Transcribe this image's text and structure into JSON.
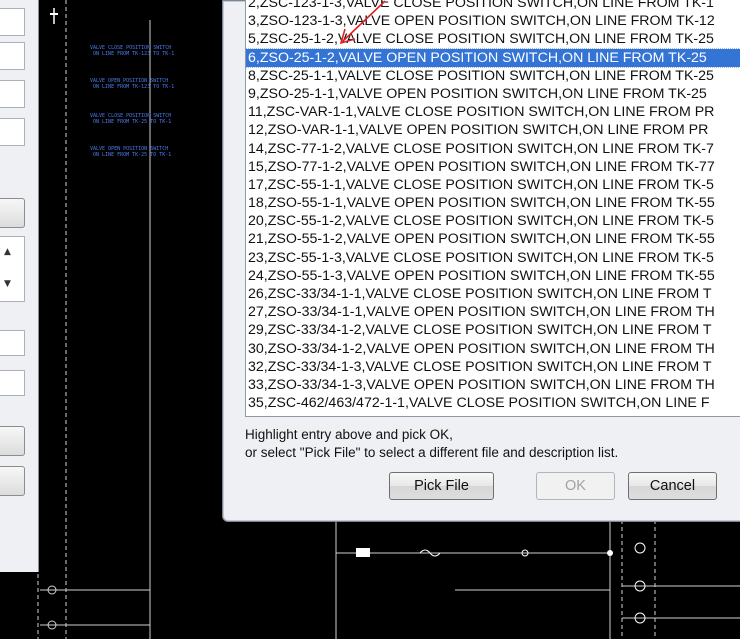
{
  "dialog": {
    "entries": [
      "2,ZSC-123-1-3,VALVE CLOSE POSITION SWITCH,ON LINE FROM TK-1",
      "3,ZSO-123-1-3,VALVE OPEN POSITION SWITCH,ON LINE FROM TK-12",
      "5,ZSC-25-1-2,VALVE CLOSE POSITION SWITCH,ON LINE FROM TK-25",
      "6,ZSO-25-1-2,VALVE OPEN POSITION SWITCH,ON LINE FROM TK-25",
      "8,ZSC-25-1-1,VALVE CLOSE POSITION SWITCH,ON LINE FROM TK-25",
      "9,ZSO-25-1-1,VALVE OPEN POSITION SWITCH,ON LINE FROM TK-25",
      "11,ZSC-VAR-1-1,VALVE CLOSE POSITION SWITCH,ON LINE FROM PR",
      "12,ZSO-VAR-1-1,VALVE OPEN POSITION SWITCH,ON LINE FROM PR",
      "14,ZSC-77-1-2,VALVE CLOSE POSITION SWITCH,ON LINE FROM TK-7",
      "15,ZSO-77-1-2,VALVE OPEN POSITION SWITCH,ON LINE FROM TK-77",
      "17,ZSC-55-1-1,VALVE CLOSE POSITION SWITCH,ON LINE FROM TK-5",
      "18,ZSO-55-1-1,VALVE OPEN POSITION SWITCH,ON LINE FROM TK-55",
      "20,ZSC-55-1-2,VALVE CLOSE POSITION SWITCH,ON LINE FROM TK-5",
      "21,ZSO-55-1-2,VALVE OPEN POSITION SWITCH,ON LINE FROM TK-55",
      "23,ZSC-55-1-3,VALVE CLOSE POSITION SWITCH,ON LINE FROM TK-5",
      "24,ZSO-55-1-3,VALVE OPEN POSITION SWITCH,ON LINE FROM TK-55",
      "26,ZSC-33/34-1-1,VALVE CLOSE POSITION SWITCH,ON LINE FROM T",
      "27,ZSO-33/34-1-1,VALVE OPEN POSITION SWITCH,ON LINE FROM TH",
      "29,ZSC-33/34-1-2,VALVE CLOSE POSITION SWITCH,ON LINE FROM T",
      "30,ZSO-33/34-1-2,VALVE OPEN POSITION SWITCH,ON LINE FROM TH",
      "32,ZSC-33/34-1-3,VALVE CLOSE POSITION SWITCH,ON LINE FROM T",
      "33,ZSO-33/34-1-3,VALVE OPEN POSITION SWITCH,ON LINE FROM TH",
      "35,ZSC-462/463/472-1-1,VALVE CLOSE POSITION SWITCH,ON LINE F"
    ],
    "selected_entry": "6,ZSO-25-1-2,VALVE OPEN POSITION SWITCH,ON LINE FROM TK-25",
    "help_line1": "Highlight entry above and pick OK,",
    "help_line2": "or select \"Pick File\" to select a different file and description list.",
    "pick_file_label": "Pick File",
    "ok_label": "OK",
    "cancel_label": "Cancel",
    "selection_color": "#3474d4",
    "arrow_color": "#e02020"
  },
  "cad": {
    "block_notes": [
      "VALVE CLOSE POSITION SWITCH\n ON LINE FROM TK-123 TO TK-1",
      "VALVE OPEN POSITION SWITCH\n ON LINE FROM TK-123 TO TK-1",
      "VALVE CLOSE POSITION SWITCH\n ON LINE FROM TK-25 TO TK-1",
      "VALVE OPEN POSITION SWITCH\n ON LINE FROM TK-25 TO TK-1"
    ],
    "text_color": "#4b7bf0"
  }
}
